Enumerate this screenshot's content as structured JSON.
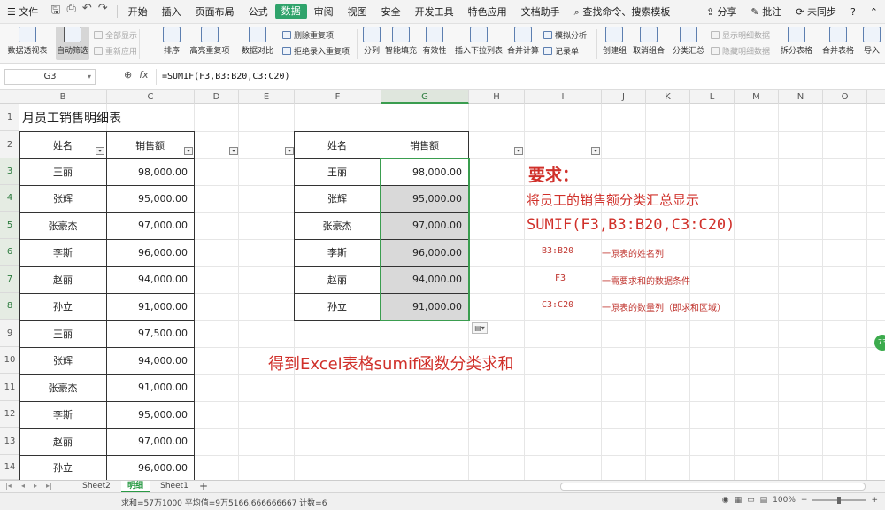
{
  "menubar": {
    "file": "文件",
    "tabs": [
      "开始",
      "插入",
      "页面布局",
      "公式",
      "数据",
      "审阅",
      "视图",
      "安全",
      "开发工具",
      "特色应用",
      "文档助手"
    ],
    "active_tab": "数据",
    "search": "查找命令、搜索模板",
    "share": "分享",
    "annotate": "批注",
    "sync": "未同步"
  },
  "ribbon": {
    "pivot": "数据透视表",
    "autofilter": "自动筛选",
    "show_all": "全部显示",
    "reapply": "重新应用",
    "sort": "排序",
    "highlight_dup": "高亮重复项",
    "compare": "数据对比",
    "remove_dup": "删除重复项",
    "reject_dup": "拒绝录入重复项",
    "split": "分列",
    "smart_fill": "智能填充",
    "validity": "有效性",
    "dropdown": "插入下拉列表",
    "consolidate": "合并计算",
    "simulate": "模拟分析",
    "records": "记录单",
    "group": "创建组",
    "ungroup": "取消组合",
    "subtotal": "分类汇总",
    "show_detail": "显示明细数据",
    "hide_detail": "隐藏明细数据",
    "split_table": "拆分表格",
    "merge_table": "合并表格",
    "import": "导入"
  },
  "formula_bar": {
    "cell_ref": "G3",
    "formula": "=SUMIF(F3,B3:B20,C3:C20)"
  },
  "columns": [
    "B",
    "C",
    "D",
    "E",
    "F",
    "G",
    "H",
    "I",
    "J",
    "K",
    "L",
    "M",
    "N",
    "O"
  ],
  "rows": [
    "1",
    "2",
    "3",
    "4",
    "5",
    "6",
    "7",
    "8",
    "9",
    "10",
    "11",
    "12",
    "13",
    "14"
  ],
  "sheet": {
    "title": "月员工销售明细表",
    "left_table": {
      "headers": [
        "姓名",
        "销售额"
      ],
      "rows": [
        [
          "王丽",
          "98,000.00"
        ],
        [
          "张辉",
          "95,000.00"
        ],
        [
          "张豪杰",
          "97,000.00"
        ],
        [
          "李斯",
          "96,000.00"
        ],
        [
          "赵丽",
          "94,000.00"
        ],
        [
          "孙立",
          "91,000.00"
        ],
        [
          "王丽",
          "97,500.00"
        ],
        [
          "张辉",
          "94,000.00"
        ],
        [
          "张豪杰",
          "91,000.00"
        ],
        [
          "李斯",
          "95,000.00"
        ],
        [
          "赵丽",
          "97,000.00"
        ],
        [
          "孙立",
          "96,000.00"
        ]
      ]
    },
    "right_table": {
      "headers": [
        "姓名",
        "销售额"
      ],
      "rows": [
        [
          "王丽",
          "98,000.00"
        ],
        [
          "张辉",
          "95,000.00"
        ],
        [
          "张豪杰",
          "97,000.00"
        ],
        [
          "李斯",
          "96,000.00"
        ],
        [
          "赵丽",
          "94,000.00"
        ],
        [
          "孙立",
          "91,000.00"
        ]
      ]
    },
    "notes": {
      "heading": "要求：",
      "desc": "将员工的销售额分类汇总显示",
      "formula": "SUMIF(F3,B3:B20,C3:C20)",
      "arg1": "B3:B20",
      "arg1_desc": "一原表的姓名列",
      "arg2": "F3",
      "arg2_desc": "一需要求和的数据条件",
      "arg3": "C3:C20",
      "arg3_desc": "一原表的数量列（即求和区域）",
      "result": "得到Excel表格sumif函数分类求和"
    }
  },
  "sheet_tabs": [
    "Sheet2",
    "明细",
    "Sheet1"
  ],
  "active_sheet": "明细",
  "status": {
    "summary": "求和=57万1000   平均值=9万5166.666666667   计数=6",
    "zoom": "100%"
  },
  "badge": "73",
  "colors": {
    "accent": "#2fa36b",
    "note_red": "#d0302a",
    "selection": "#3a9d4f"
  }
}
